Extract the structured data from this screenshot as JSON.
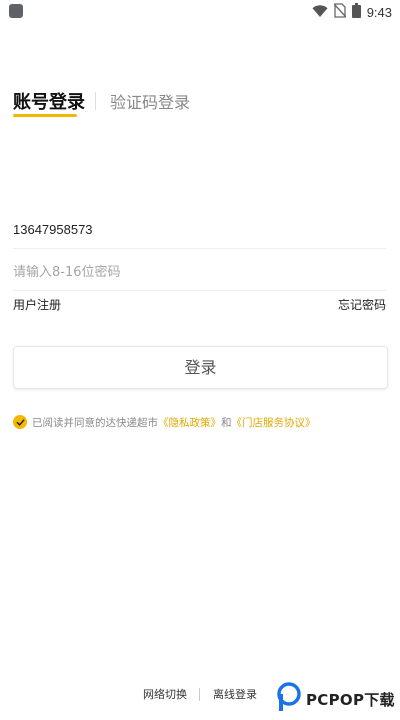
{
  "status_bar": {
    "time": "9:43",
    "icons": [
      "app-icon",
      "wifi-icon",
      "no-sim-icon",
      "battery-icon"
    ]
  },
  "tabs": {
    "active": "账号登录",
    "inactive": "验证码登录"
  },
  "form": {
    "phone_value": "13647958573",
    "password_placeholder": "请输入8-16位密码",
    "register_label": "用户注册",
    "forgot_label": "忘记密码",
    "login_label": "登录"
  },
  "agreement": {
    "checked": true,
    "prefix": "已阅读并同意的达快递超市",
    "privacy_link": "《隐私政策》",
    "and": "和",
    "service_link": "《门店服务协议》"
  },
  "footer": {
    "network_switch": "网络切换",
    "offline_login": "离线登录"
  },
  "watermark": {
    "text": "PCPOP下载"
  },
  "colors": {
    "accent": "#f5b800",
    "link": "#e0a800",
    "placeholder": "#a5a5a5"
  }
}
